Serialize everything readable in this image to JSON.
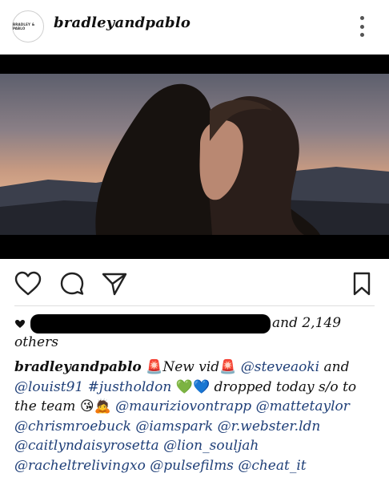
{
  "post": {
    "avatar_text": "BRADLEY & PABLO",
    "username": "bradleyandpablo"
  },
  "likes": {
    "tail": "and 2,149",
    "others": "others"
  },
  "caption": {
    "username": "bradleyandpablo",
    "siren": "🚨",
    "text1": "New vid",
    "tag_steveaoki": "@steveaoki",
    "and": "and",
    "tag_louist91": "@louist91",
    "hashtag": "#justholdon",
    "hearts": "💚💙",
    "dropped": "dropped today s/o to",
    "the_team": "the team",
    "team_emojis": "😘🙇",
    "tag_maurizio": "@mauriziovontrapp",
    "tag_mattetaylor": "@mattetaylor",
    "tag_chrismroebuck": "@chrismroebuck",
    "tag_iamspark": "@iamspark",
    "tag_rwebster": "@r.webster.ldn",
    "tag_caitlyn": "@caitlyndaisyrosetta",
    "tag_lion": "@lion_souljah",
    "tag_rachel": "@racheltrelivingxo",
    "tag_pulse": "@pulsefilms",
    "tag_cheat": "@cheat_it"
  },
  "icons": {
    "like": "heart-icon",
    "comment": "comment-icon",
    "share": "share-icon",
    "save": "bookmark-icon",
    "more": "more-options-icon"
  }
}
